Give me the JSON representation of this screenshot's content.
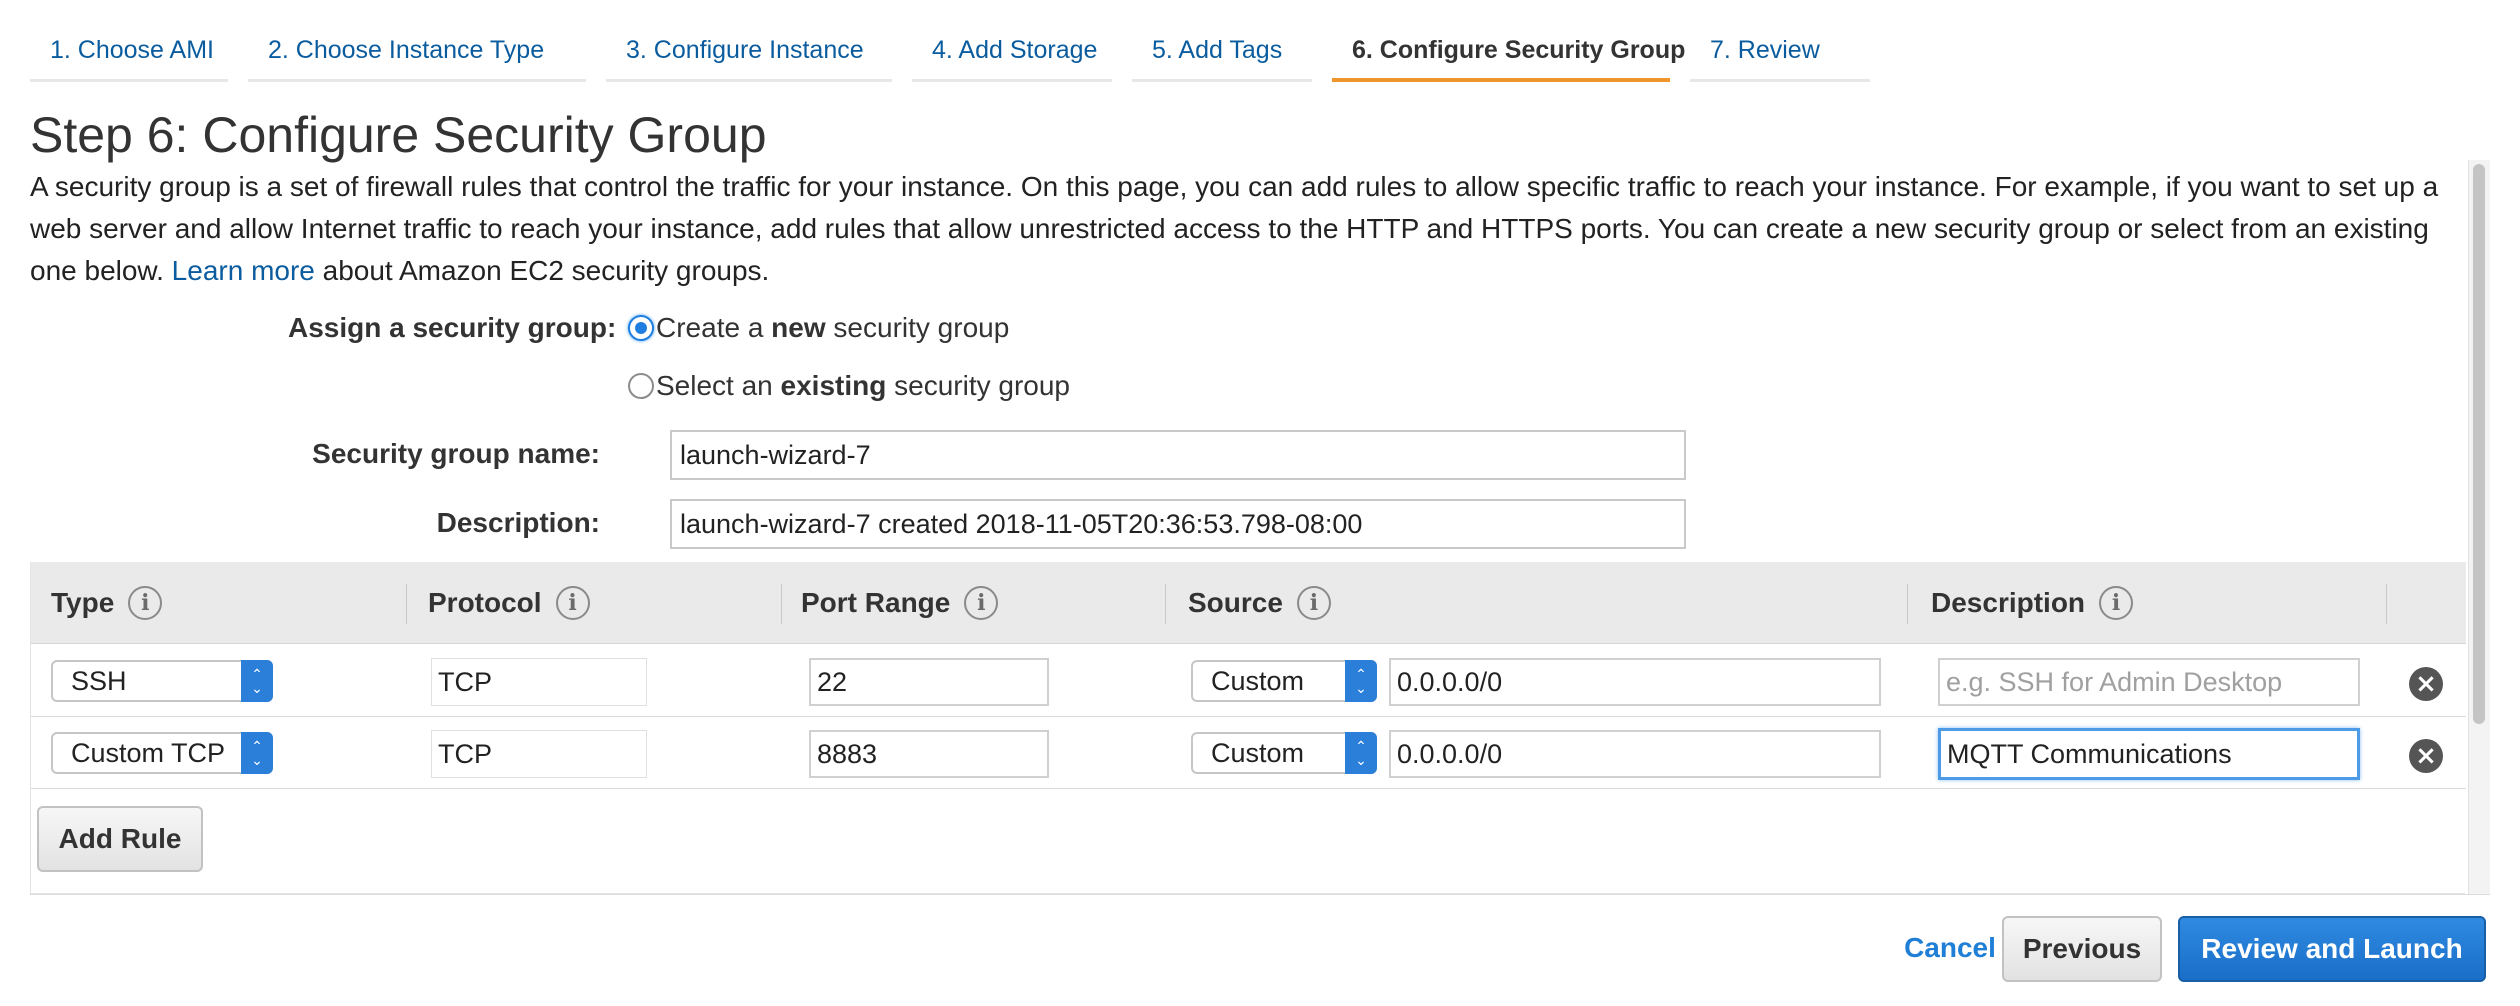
{
  "tabs": [
    {
      "label": "1. Choose AMI"
    },
    {
      "label": "2. Choose Instance Type"
    },
    {
      "label": "3. Configure Instance"
    },
    {
      "label": "4. Add Storage"
    },
    {
      "label": "5. Add Tags"
    },
    {
      "label": "6. Configure Security Group",
      "active": true
    },
    {
      "label": "7. Review"
    }
  ],
  "page": {
    "title": "Step 6: Configure Security Group",
    "intro_before_link": "A security group is a set of firewall rules that control the traffic for your instance. On this page, you can add rules to allow specific traffic to reach your instance. For example, if you want to set up a web server and allow Internet traffic to reach your instance, add rules that allow unrestricted access to the HTTP and HTTPS ports. You can create a new security group or select from an existing one below. ",
    "intro_link": "Learn more",
    "intro_after_link": " about Amazon EC2 security groups."
  },
  "assign": {
    "label": "Assign a security group:",
    "option_create": {
      "prefix": "Create a ",
      "bold": "new",
      "suffix": " security group",
      "selected": true
    },
    "option_existing": {
      "prefix": "Select an ",
      "bold": "existing",
      "suffix": " security group",
      "selected": false
    }
  },
  "group_name": {
    "label": "Security group name:",
    "value": "launch-wizard-7"
  },
  "group_description": {
    "label": "Description:",
    "value": "launch-wizard-7 created 2018-11-05T20:36:53.798-08:00"
  },
  "table": {
    "headers": {
      "type": "Type",
      "protocol": "Protocol",
      "port_range": "Port Range",
      "source": "Source",
      "description": "Description"
    },
    "info_glyph": "i",
    "rows": [
      {
        "type": "SSH",
        "protocol": "TCP",
        "port_range": "22",
        "source_mode": "Custom",
        "source_cidr": "0.0.0.0/0",
        "description": "",
        "description_placeholder": "e.g. SSH for Admin Desktop"
      },
      {
        "type": "Custom TCP",
        "protocol": "TCP",
        "port_range": "8883",
        "source_mode": "Custom",
        "source_cidr": "0.0.0.0/0",
        "description": "MQTT Communications",
        "description_placeholder": ""
      }
    ],
    "remove_glyph": "×",
    "select_arrow_up": "⌃",
    "select_arrow_down": "⌄"
  },
  "buttons": {
    "add_rule": "Add Rule",
    "cancel": "Cancel",
    "previous": "Previous",
    "review_launch": "Review and Launch"
  },
  "colors": {
    "link": "#0a5c9e",
    "active_tab_underline": "#f0962c",
    "primary_button": "#1a6ec8",
    "select_arrow": "#2b7fd9"
  }
}
